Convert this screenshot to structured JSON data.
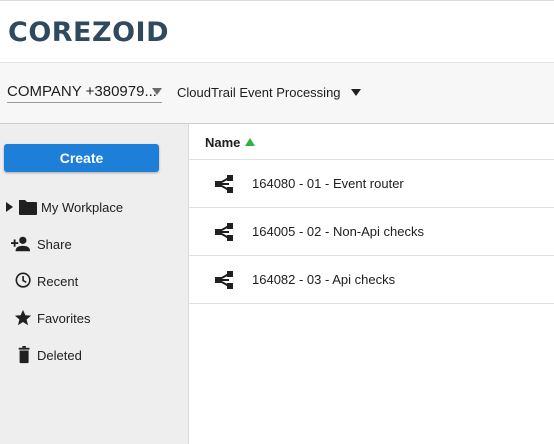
{
  "brand": {
    "logo_text": "COREZOID"
  },
  "toolbar": {
    "company_label": "COMPANY +380979...",
    "project_label": "CloudTrail Event Processing"
  },
  "sidebar": {
    "create_label": "Create",
    "items": [
      {
        "label": "My Workplace",
        "icon": "folder-icon",
        "expandable": true
      },
      {
        "label": "Share",
        "icon": "add-person-icon"
      },
      {
        "label": "Recent",
        "icon": "clock-icon"
      },
      {
        "label": "Favorites",
        "icon": "star-icon"
      },
      {
        "label": "Deleted",
        "icon": "trash-icon"
      }
    ]
  },
  "list": {
    "column_name": "Name",
    "sort": "ascending",
    "rows": [
      {
        "label": "164080 - 01 - Event router",
        "icon": "process-icon"
      },
      {
        "label": "164005 - 02 - Non-Api checks",
        "icon": "process-icon"
      },
      {
        "label": "164082 - 03 - Api checks",
        "icon": "process-icon"
      }
    ]
  },
  "colors": {
    "brand": "#2f4a5e",
    "primary_button": "#1e7fd8",
    "sort_indicator": "#2fb33f",
    "sidebar_bg": "#eeeeee"
  }
}
